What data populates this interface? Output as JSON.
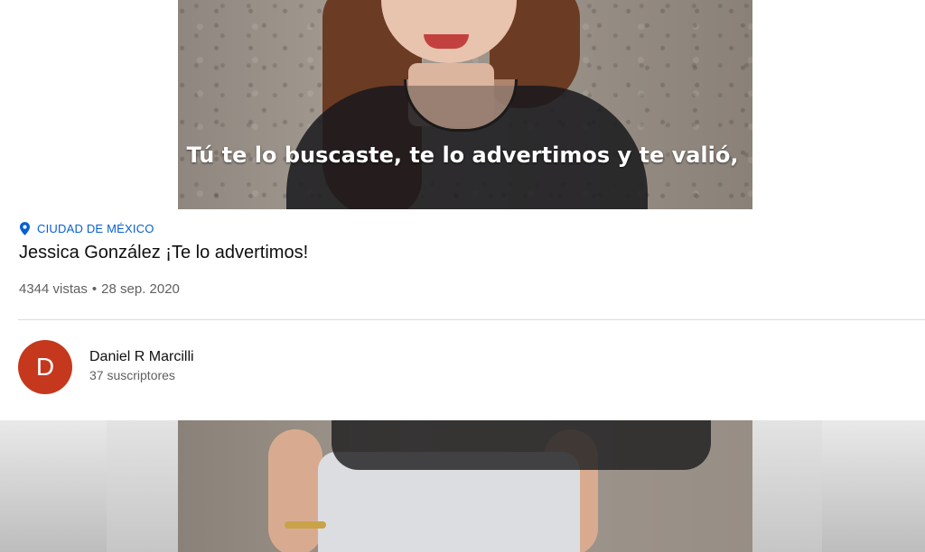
{
  "video": {
    "caption": "Tú te lo buscaste, te lo advertimos y te valió,"
  },
  "details": {
    "location_icon": "location-pin-icon",
    "location": "CIUDAD DE MÉXICO",
    "title": "Jessica González ¡Te lo advertimos!",
    "views": "4344 vistas",
    "separator": "•",
    "date": "28 sep. 2020"
  },
  "channel": {
    "avatar_letter": "D",
    "avatar_color": "#c5381d",
    "name": "Daniel R Marcilli",
    "subscribers": "37 suscriptores"
  },
  "colors": {
    "link_blue": "#065fd4",
    "secondary_text": "#606060"
  }
}
